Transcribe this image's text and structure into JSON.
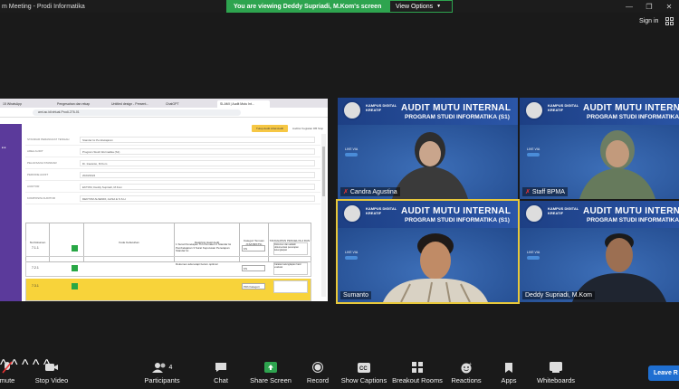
{
  "window": {
    "title": "m Meeting - Prodi Informatika"
  },
  "banner": {
    "message": "You are viewing Deddy Supriadi, M.Kom's screen",
    "view_options": "View Options"
  },
  "header": {
    "sign_in": "Sign in"
  },
  "shared_screen": {
    "tabs": [
      "15 WhatsApp",
      "Pengesahan dan rekap",
      "Untitled design - Present...",
      "ChatGPT",
      "SI-AMI | Audit Mutu Int..."
    ],
    "url": "ami.ac.id/virtual-Prodi-276-01",
    "app_button": "Tutup Audit Lihat Audit",
    "top_right": "Auditor Kegiatan DB Stop",
    "form_rows": [
      {
        "label": "STANDAR PERANGKAT TENGAH",
        "value": "Standar Isi Pembelajaran"
      },
      {
        "label": "AREA AUDIT",
        "value": "Program Studi Informatika (S1)"
      },
      {
        "label": "PELAKSANA STANDAR",
        "value": "Dr. Irawanto, M.Kom"
      },
      {
        "label": "PERIODE AUDIT",
        "value": "2023/2024"
      },
      {
        "label": "AUDITOR",
        "value": "EKTOM, Deddy Supriadi, M.Kom"
      },
      {
        "label": "KOMPOSISI AUDITOR",
        "value": "DEKTOM ALSENDI, ALISA E S.S.H"
      }
    ],
    "table_headers": [
      "No Dokumen",
      "",
      "Kode Kebutuhan",
      "Deskripsi Hasil Audit",
      "Kategori Temuan (KS/OB/KTS)",
      "TANGGAPAN PENGELOLA DAN RENCANA PERBAIKAN"
    ],
    "rows": [
      {
        "no": "7.1.1",
        "desc": "1 Surat Penetapan Tim Pemateri 2 Standar Isi Pembelajaran 3 Surat Keputusan Penetapan Standar Isi",
        "sel": "KS",
        "far": "Dokumen dan adalah dokumentasi penerapan kelengkapan"
      },
      {
        "no": "7.2.1",
        "desc": "Dokumen ada tetapi belum optimal",
        "sel": "KS",
        "far": "Catatan kelengkapan hasil evaluasi"
      },
      {
        "no": "7.3.1",
        "desc": "",
        "sel": "Pilih Kategori",
        "far": ""
      }
    ]
  },
  "participants": [
    {
      "name": "Candra Agustina",
      "muted": true
    },
    {
      "name": "Staff BPMA",
      "muted": true
    },
    {
      "name": "Sumanto",
      "muted": false
    },
    {
      "name": "Deddy Supriadi, M.Kom",
      "muted": false
    }
  ],
  "tile_text": {
    "kampus": "KAMPUS DIGITAL KREATIF",
    "h1": "AUDIT MUTU INTERNAL",
    "h2": "PROGRAM STUDI INFORMATIKA (S1)",
    "live": "LIVE VIA"
  },
  "toolbar": {
    "unmute": "mute",
    "stop_video": "Stop Video",
    "participants": "Participants",
    "participants_count": "4",
    "chat": "Chat",
    "share_screen": "Share Screen",
    "record": "Record",
    "show_captions": "Show Captions",
    "breakout_rooms": "Breakout Rooms",
    "reactions": "Reactions",
    "apps": "Apps",
    "whiteboards": "Whiteboards",
    "leave": "Leave R"
  },
  "colors": {
    "banner_green": "#2ea44f",
    "leave_blue": "#1f6fd1",
    "tile_blue": "#2c4e8e",
    "active_outline": "#e8c83a"
  }
}
